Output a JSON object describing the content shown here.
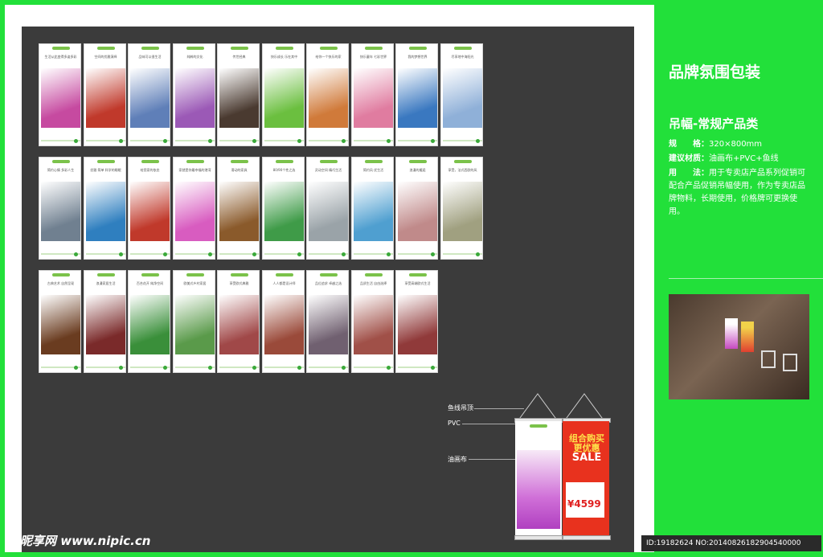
{
  "title": "品牌氛围包装",
  "subtitle": "吊幅-常规产品类",
  "specs": {
    "size_label": "规　　格：",
    "size_value": "320×800mm",
    "material_label": "建议材质：",
    "material_value": "油画布+PVC+鱼线",
    "usage_label": "用　　法：",
    "usage_value": "用于专卖店产品系列促销可配合产品促销吊幅使用，作为专卖店品牌物料，长期使用，价格牌可更换使用。"
  },
  "diagram_labels": {
    "hook": "鱼线吊顶",
    "pvc": "PVC",
    "canvas": "油画布"
  },
  "sale_card": {
    "headline": "组合购买更优惠",
    "sale": "SALE",
    "price": "¥4599"
  },
  "watermark": {
    "site": "昵享网 www.nipic.cn",
    "id": "ID:19182624 NO:20140826182904540000"
  },
  "rows": [
    [
      {
        "slogan": "生活从此变得多姿多彩",
        "color": "#c64aa0"
      },
      {
        "slogan": "空间的优雅演绎",
        "color": "#c0392b"
      },
      {
        "slogan": "品味可以很生活",
        "color": "#5f7fb8"
      },
      {
        "slogan": "纯粹的文化",
        "color": "#9b59b6"
      },
      {
        "slogan": "传世经典",
        "color": "#4a3a30"
      },
      {
        "slogan": "快乐成长 乐在其中",
        "color": "#6bbf3f"
      },
      {
        "slogan": "给你一个快乐的家",
        "color": "#d07a3a"
      },
      {
        "slogan": "快乐童年 七彩世界",
        "color": "#e07ca0"
      },
      {
        "slogan": "我的梦想世界",
        "color": "#3a78c0"
      },
      {
        "slogan": "尽享地中海阳光",
        "color": "#8fb0d8"
      }
    ],
    [
      {
        "slogan": "简约心情 多彩人生",
        "color": "#708090"
      },
      {
        "slogan": "优雅 简单 科学的睡眠",
        "color": "#2f7fbf"
      },
      {
        "slogan": "给您家的依恋",
        "color": "#c0392b"
      },
      {
        "slogan": "家就是你最幸福的港湾",
        "color": "#d85cc0"
      },
      {
        "slogan": "滑动的家具",
        "color": "#8a5a2b"
      },
      {
        "slogan": "80/90个性之选",
        "color": "#3f9b48"
      },
      {
        "slogan": "灵动空间 精巧生活",
        "color": "#9aa3a8"
      },
      {
        "slogan": "简约风 优生活",
        "color": "#4f9fd0"
      },
      {
        "slogan": "浪漫的邂逅",
        "color": "#c08a8a"
      },
      {
        "slogan": "享受，法式西欧的风",
        "color": "#a0a080"
      }
    ],
    [
      {
        "slogan": "古典艺术 自然呈现",
        "color": "#6a3c20"
      },
      {
        "slogan": "浪漫家居生活",
        "color": "#7a2a2a"
      },
      {
        "slogan": "百合花开 纯净空间",
        "color": "#3a8f3a"
      },
      {
        "slogan": "欧美式乡村家居",
        "color": "#5a9a4a"
      },
      {
        "slogan": "享受欧式典雅",
        "color": "#a04848"
      },
      {
        "slogan": "人人都是设计师",
        "color": "#9a4a3a"
      },
      {
        "slogan": "品位追求 卓越之选",
        "color": "#706070"
      },
      {
        "slogan": "品质生活 自由选择",
        "color": "#a05048"
      },
      {
        "slogan": "享受高端欧式生活",
        "color": "#903a3a"
      }
    ]
  ]
}
